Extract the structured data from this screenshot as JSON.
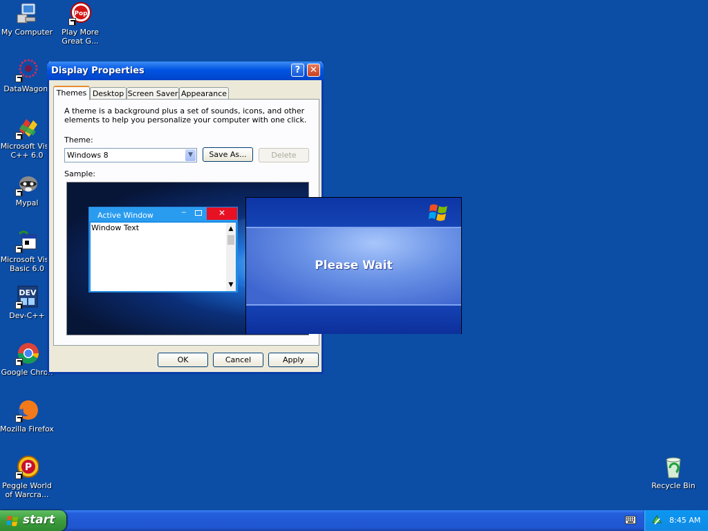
{
  "desktop": {
    "icons": [
      {
        "label_1": "My Computer",
        "label_2": "",
        "icon": "my-computer-icon"
      },
      {
        "label_1": "Play More",
        "label_2": "Great G...",
        "icon": "popcap-icon"
      },
      {
        "label_1": "DataWagon.",
        "label_2": "",
        "icon": "datawagon-icon"
      },
      {
        "label_1": "Microsoft Visu",
        "label_2": "C++ 6.0",
        "icon": "visual-cpp-icon"
      },
      {
        "label_1": "Mypal",
        "label_2": "",
        "icon": "mypal-icon"
      },
      {
        "label_1": "Microsoft Visu",
        "label_2": "Basic 6.0",
        "icon": "visual-basic-icon"
      },
      {
        "label_1": "Dev-C++",
        "label_2": "",
        "icon": "dev-cpp-icon"
      },
      {
        "label_1": "Google Chron",
        "label_2": "",
        "icon": "chrome-icon"
      },
      {
        "label_1": "Mozilla Firefox",
        "label_2": "",
        "icon": "firefox-icon"
      },
      {
        "label_1": "Peggle World",
        "label_2": "of Warcra...",
        "icon": "peggle-icon"
      },
      {
        "label_1": "Recycle Bin",
        "label_2": "",
        "icon": "recycle-bin-icon"
      }
    ],
    "dev_icon_text": "DEV"
  },
  "dialog": {
    "title": "Display Properties",
    "help_glyph": "?",
    "close_glyph": "✕",
    "tabs": [
      "Themes",
      "Desktop",
      "Screen Saver",
      "Appearance"
    ],
    "active_tab": "Themes",
    "description": "A theme is a background plus a set of sounds, icons, and other elements to help you personalize your computer with one click.",
    "theme_label": "Theme:",
    "theme_value": "Windows 8",
    "save_as": "Save As...",
    "delete": "Delete",
    "sample_label": "Sample:",
    "sample": {
      "window_title": "Active Window",
      "window_text": "Window Text",
      "minimize_glyph": "‒",
      "close_glyph": "✕"
    },
    "ok": "OK",
    "cancel": "Cancel",
    "apply": "Apply"
  },
  "splash": {
    "message": "Please Wait"
  },
  "taskbar": {
    "start_label": "start",
    "clock": "8:45 AM"
  },
  "colors": {
    "desktop_bg": "#0c4da6",
    "titlebar": "#0054e3",
    "start_green": "#3c9c3c",
    "tray_blue": "#0c97f2"
  }
}
